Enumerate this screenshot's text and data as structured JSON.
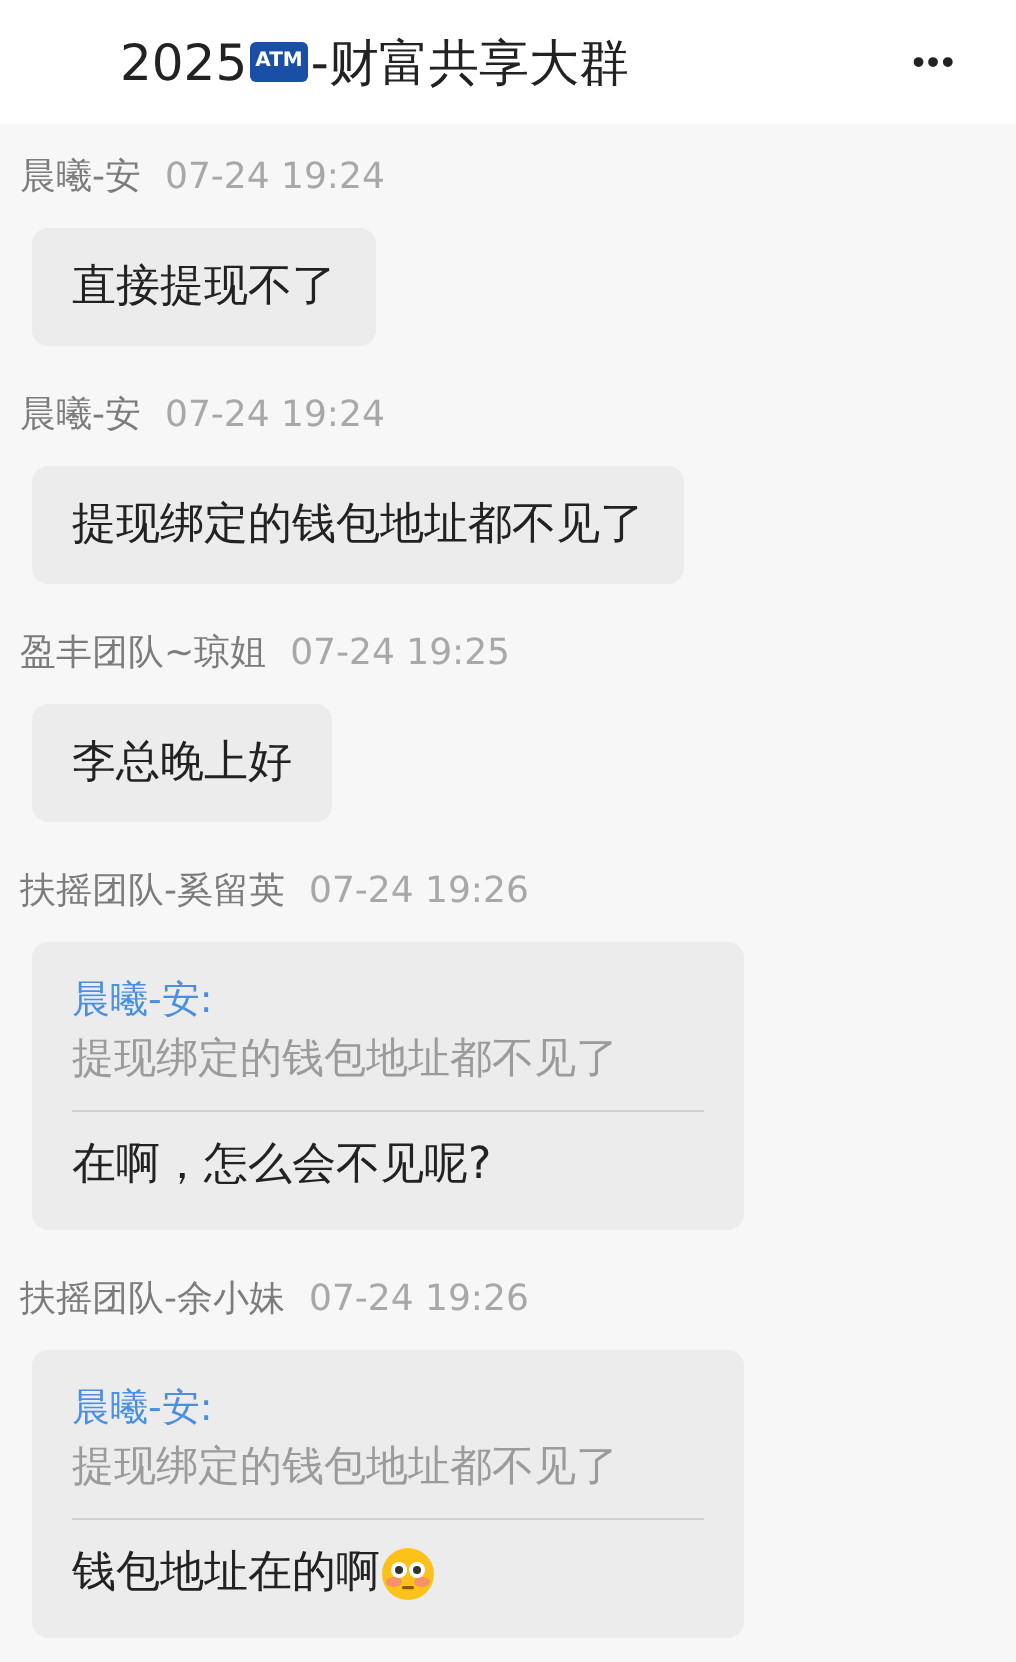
{
  "header": {
    "title_prefix": "2025",
    "title_badge": "ATM",
    "title_suffix": "-财富共享大群",
    "more": "•••"
  },
  "messages": [
    {
      "kind": "text",
      "sender": "晨曦-安",
      "time": "07-24 19:24",
      "text": "直接提现不了"
    },
    {
      "kind": "text",
      "sender": "晨曦-安",
      "time": "07-24 19:24",
      "text": "提现绑定的钱包地址都不见了"
    },
    {
      "kind": "text",
      "sender": "盈丰团队~琼姐",
      "time": "07-24 19:25",
      "text": "李总晚上好"
    },
    {
      "kind": "quote",
      "sender": "扶摇团队-奚留英",
      "time": "07-24 19:26",
      "quote_author": "晨曦-安:",
      "quote_text": "提现绑定的钱包地址都不见了",
      "text": "在啊，怎么会不见呢?"
    },
    {
      "kind": "quote",
      "sender": "扶摇团队-余小妹",
      "time": "07-24 19:26",
      "quote_author": "晨曦-安:",
      "quote_text": "提现绑定的钱包地址都不见了",
      "text": "钱包地址在的啊",
      "trailing_emoji": true
    }
  ]
}
